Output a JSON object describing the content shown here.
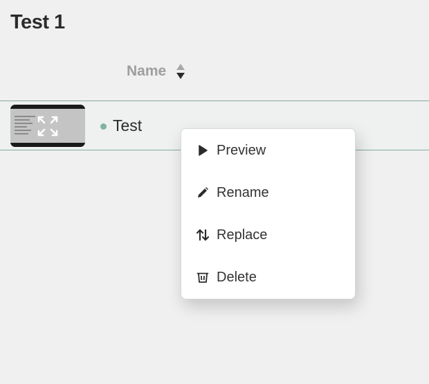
{
  "page": {
    "title": "Test 1"
  },
  "table": {
    "columns": [
      {
        "label": "Name",
        "sort_icon": "sort-up-down-icon"
      }
    ],
    "rows": [
      {
        "name": "Test",
        "status_color": "#7fb3a3",
        "thumbnail_icon": "expand-icon"
      }
    ]
  },
  "context_menu": {
    "items": [
      {
        "label": "Preview",
        "icon": "play-icon"
      },
      {
        "label": "Rename",
        "icon": "pencil-icon"
      },
      {
        "label": "Replace",
        "icon": "swap-arrows-icon"
      },
      {
        "label": "Delete",
        "icon": "trash-icon"
      }
    ]
  },
  "colors": {
    "background": "#f0f0f0",
    "row_border": "#7fa99b",
    "accent": "#7fb3a3",
    "header_text": "#9e9e9e"
  }
}
